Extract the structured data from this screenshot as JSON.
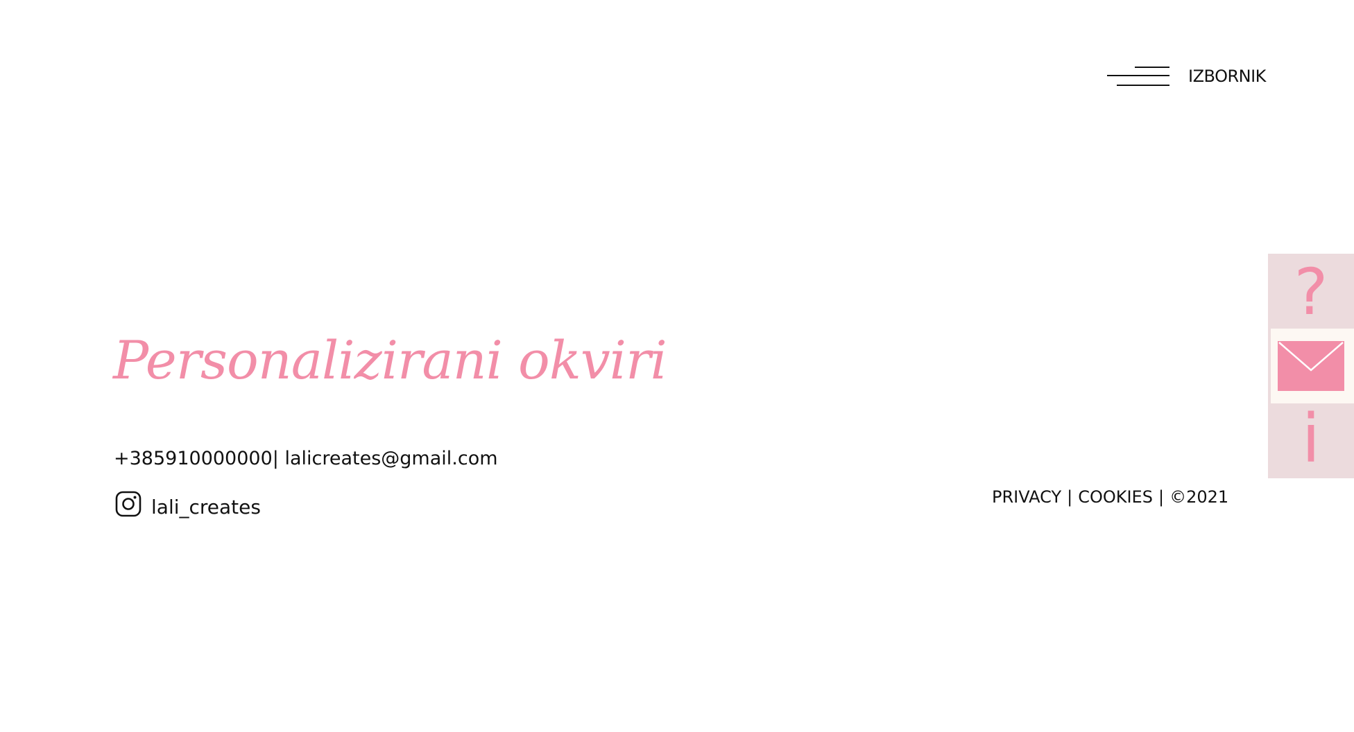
{
  "header": {
    "menu_label": "IZBORNIK"
  },
  "brand": {
    "title": "Personalizirani okviri",
    "accent_color": "#f28ea8"
  },
  "contact": {
    "phone": "+385910000000",
    "separator": "|",
    "email": "lalicreates@gmail.com",
    "instagram_handle": "lali_creates"
  },
  "footer": {
    "privacy": "PRIVACY",
    "cookies": "COOKIES",
    "sep": "|",
    "copyright": "©2021"
  },
  "side_tabs": {
    "help_glyph": "?",
    "info_glyph": "i",
    "icons": [
      "question-icon",
      "mail-icon",
      "info-icon"
    ],
    "background_color": "#ecdbdd"
  }
}
